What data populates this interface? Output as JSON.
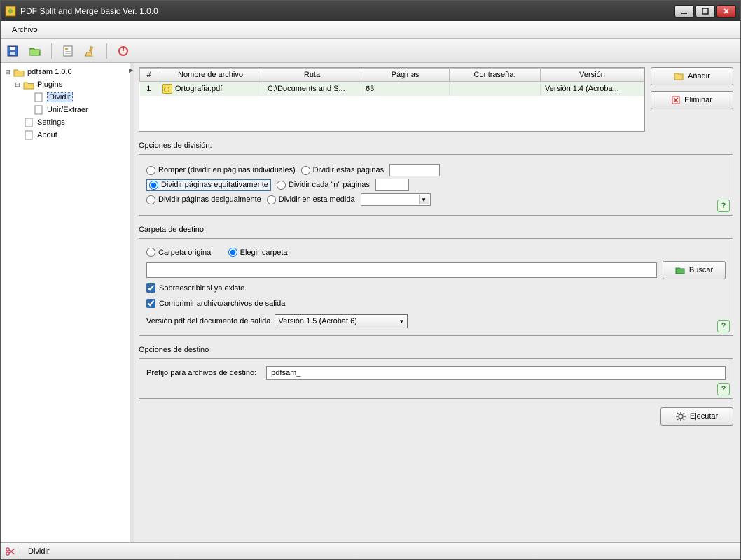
{
  "window": {
    "title": "PDF Split and Merge basic Ver. 1.0.0"
  },
  "menubar": {
    "file": "Archivo"
  },
  "tree": {
    "root": "pdfsam 1.0.0",
    "plugins": "Plugins",
    "dividir": "Dividir",
    "unir": "Unir/Extraer",
    "settings": "Settings",
    "about": "About"
  },
  "table": {
    "headers": {
      "num": "#",
      "name": "Nombre de archivo",
      "path": "Ruta",
      "pages": "Páginas",
      "password": "Contraseña:",
      "version": "Versión"
    },
    "rows": [
      {
        "num": "1",
        "name": "Ortografia.pdf",
        "path": "C:\\Documents and S...",
        "pages": "63",
        "password": "",
        "version": "Versión 1.4 (Acroba..."
      }
    ]
  },
  "buttons": {
    "add": "Añadir",
    "remove": "Eliminar",
    "search": "Buscar",
    "execute": "Ejecutar"
  },
  "split": {
    "section": "Opciones de división:",
    "break": "Romper (dividir en páginas individuales)",
    "these": "Dividir estas páginas",
    "equal": "Dividir páginas equitativamente",
    "every_n": "Dividir cada \"n\" páginas",
    "unequal": "Dividir páginas desigualmente",
    "measure": "Dividir en esta medida"
  },
  "dest": {
    "section": "Carpeta de destino:",
    "original": "Carpeta original",
    "choose": "Elegir carpeta",
    "overwrite": "Sobreescribir si ya existe",
    "compress": "Comprimir archivo/archivos de salida",
    "version_label": "Versión pdf del documento de salida",
    "version_value": "Versión 1.5 (Acrobat 6)"
  },
  "output": {
    "section": "Opciones de destino",
    "prefix_label": "Prefijo para archivos de destino:",
    "prefix_value": "pdfsam_"
  },
  "status": {
    "label": "Dividir"
  }
}
